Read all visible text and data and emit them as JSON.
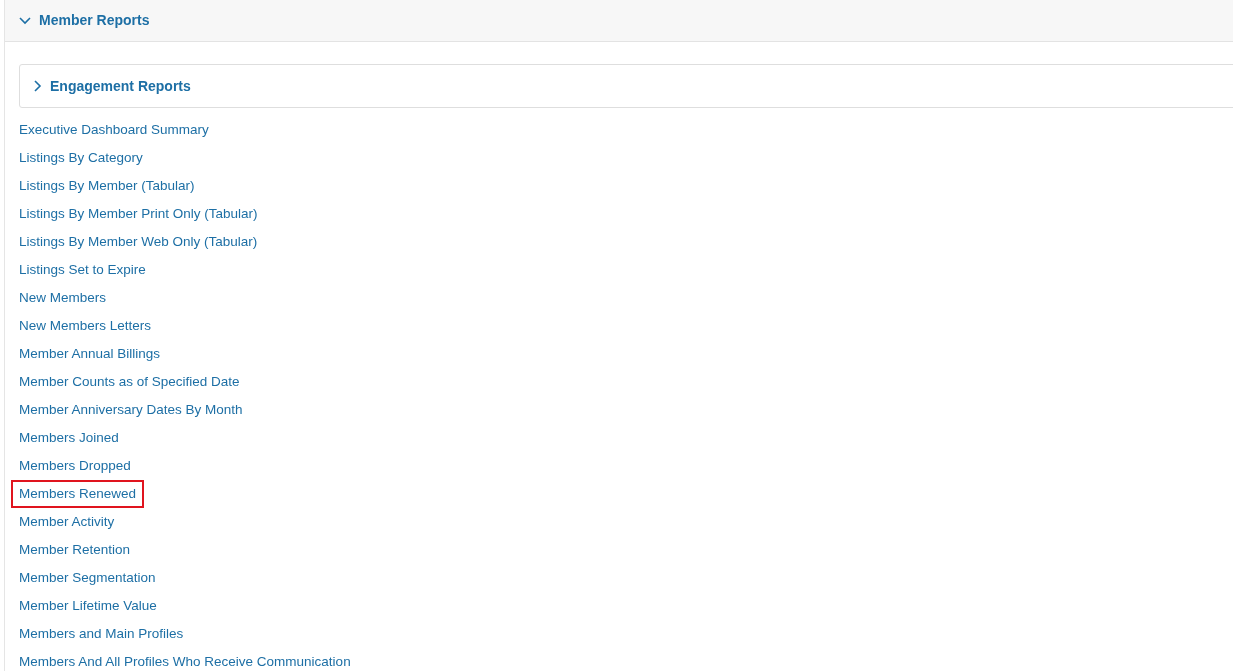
{
  "section": {
    "title": "Member Reports",
    "expanded": true
  },
  "subsection": {
    "title": "Engagement Reports",
    "expanded": false
  },
  "reports": [
    {
      "label": "Executive Dashboard Summary",
      "highlighted": false
    },
    {
      "label": "Listings By Category",
      "highlighted": false
    },
    {
      "label": "Listings By Member (Tabular)",
      "highlighted": false
    },
    {
      "label": "Listings By Member Print Only (Tabular)",
      "highlighted": false
    },
    {
      "label": "Listings By Member Web Only (Tabular)",
      "highlighted": false
    },
    {
      "label": "Listings Set to Expire",
      "highlighted": false
    },
    {
      "label": "New Members",
      "highlighted": false
    },
    {
      "label": "New Members Letters",
      "highlighted": false
    },
    {
      "label": "Member Annual Billings",
      "highlighted": false
    },
    {
      "label": "Member Counts as of Specified Date",
      "highlighted": false
    },
    {
      "label": "Member Anniversary Dates By Month",
      "highlighted": false
    },
    {
      "label": "Members Joined",
      "highlighted": false
    },
    {
      "label": "Members Dropped",
      "highlighted": false
    },
    {
      "label": "Members Renewed",
      "highlighted": true
    },
    {
      "label": "Member Activity",
      "highlighted": false
    },
    {
      "label": "Member Retention",
      "highlighted": false
    },
    {
      "label": "Member Segmentation",
      "highlighted": false
    },
    {
      "label": "Member Lifetime Value",
      "highlighted": false
    },
    {
      "label": "Members and Main Profiles",
      "highlighted": false
    },
    {
      "label": "Members And All Profiles Who Receive Communication",
      "highlighted": false
    }
  ]
}
